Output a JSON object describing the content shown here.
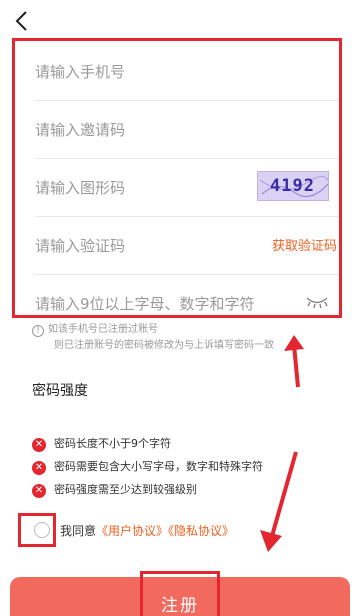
{
  "form": {
    "phone_placeholder": "请输入手机号",
    "invite_placeholder": "请输入邀请码",
    "captcha_placeholder": "请输入图形码",
    "captcha_code": "4192",
    "sms_placeholder": "请输入验证码",
    "get_code_label": "获取验证码",
    "password_placeholder": "请输入9位以上字母、数字和字符"
  },
  "note": {
    "line1": "如该手机号已注册过账号",
    "line2": "则已注册账号的密码被修改为与上诉填写密码一致"
  },
  "strength": {
    "title": "密码强度",
    "rules": [
      "密码长度不小于9个字符",
      "密码需要包含大小写字母，数字和特殊字符",
      "密码强度需至少达到较强级别"
    ]
  },
  "agreement": {
    "prefix": "我同意",
    "user_agreement": "《用户协议》",
    "privacy_agreement": "《隐私协议》"
  },
  "register_label": "注册",
  "colors": {
    "accent": "#e3262f",
    "link": "#f06020",
    "button": "#f26a5e"
  },
  "icons": [
    "back-arrow-icon",
    "eye-closed-icon",
    "info-icon",
    "error-x-icon"
  ]
}
